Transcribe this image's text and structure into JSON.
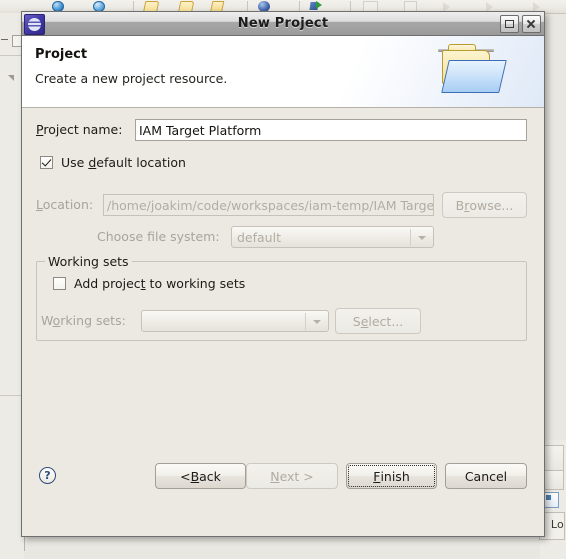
{
  "window": {
    "title": "New Project",
    "icon": "eclipse-icon",
    "maximize_label": "Maximize",
    "close_label": "Close"
  },
  "header": {
    "title": "Project",
    "description": "Create a new project resource.",
    "banner_icon": "folder-icon"
  },
  "form": {
    "project_name": {
      "label_pre": "",
      "label_mnemonic": "P",
      "label_post": "roject name:",
      "value": "IAM Target Platform",
      "placeholder": ""
    },
    "use_default_location": {
      "label_pre": "Use ",
      "label_mnemonic": "d",
      "label_post": "efault location",
      "checked": true
    },
    "location": {
      "label_mnemonic": "L",
      "label_post": "ocation:",
      "value": "/home/joakim/code/workspaces/iam-temp/IAM Targe",
      "enabled": false
    },
    "browse_button": {
      "label_pre": "B",
      "label_mnemonic": "r",
      "label_post": "owse...",
      "enabled": false
    },
    "file_system": {
      "label": "Choose file system:",
      "value": "default",
      "enabled": false
    }
  },
  "working_sets": {
    "group_title": "Working sets",
    "add_checkbox": {
      "label_pre": "Add projec",
      "label_mnemonic": "t",
      "label_post": " to working sets",
      "checked": false
    },
    "sets_label_pre": "W",
    "sets_label_mnemonic": "o",
    "sets_label_post": "rking sets:",
    "sets_value": "",
    "select_button": {
      "label_pre": "S",
      "label_mnemonic": "e",
      "label_post": "lect...",
      "enabled": false
    }
  },
  "buttons": {
    "help": "?",
    "back": {
      "pre": "< ",
      "mnemonic": "B",
      "post": "ack",
      "enabled": true
    },
    "next": {
      "pre": "",
      "mnemonic": "N",
      "post": "ext >",
      "enabled": false
    },
    "finish": {
      "pre": "",
      "mnemonic": "F",
      "post": "inish",
      "enabled": true,
      "focused": true
    },
    "cancel": {
      "pre": "Cancel",
      "mnemonic": "",
      "post": "",
      "enabled": true
    }
  },
  "background": {
    "right_panel_label": "Lo"
  },
  "colors": {
    "dialog_bg": "#ece9e3",
    "titlebar_top": "#eeeeee",
    "titlebar_bottom": "#9a9a9a",
    "field_bg": "#ffffff",
    "text": "#1d1b17",
    "disabled_text": "#b2ada3"
  }
}
